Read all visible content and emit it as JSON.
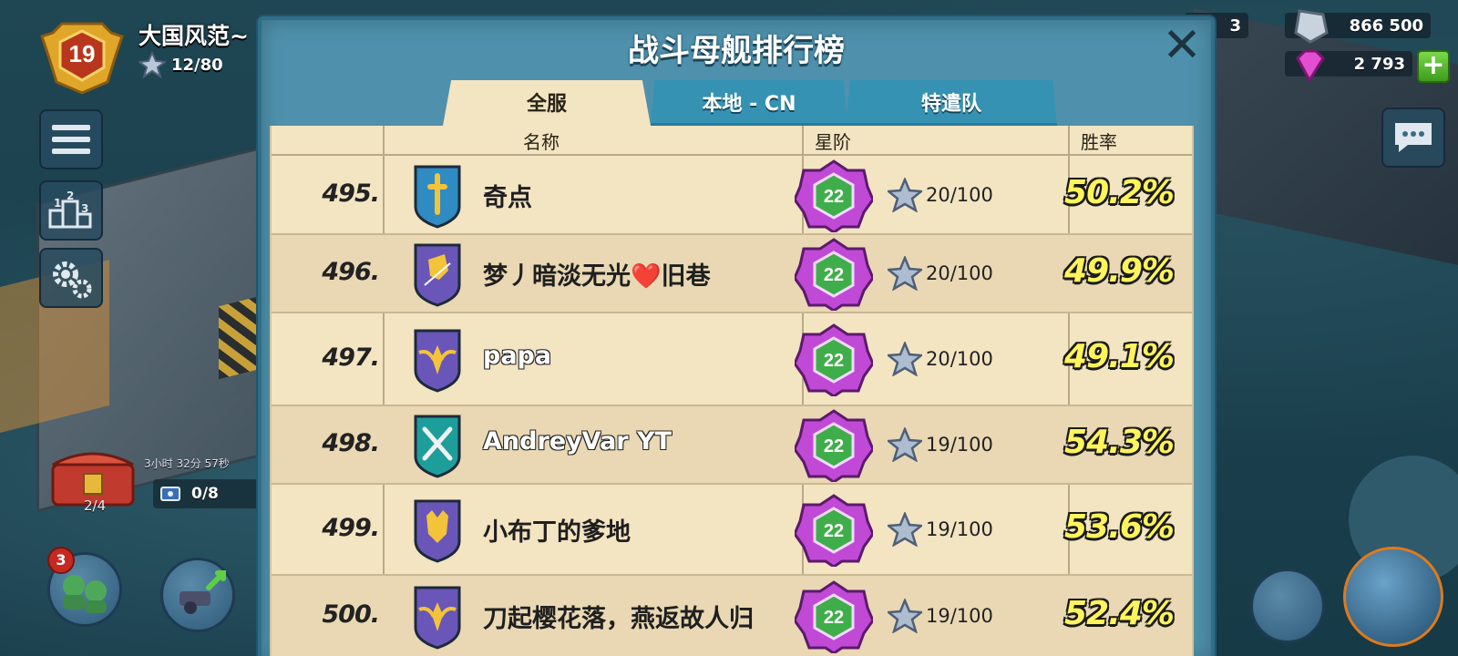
{
  "hud": {
    "level": "19",
    "player_name": "大国风范~",
    "stars": "12/80",
    "chest_timer": "3小时 32分 57秒",
    "chest_count": "2/4",
    "key_count": "0/8",
    "notification_count": "3",
    "partial_resource": "3",
    "iron_amount": "866 500",
    "gems_amount": "2 793",
    "icons": [
      "level-shield-icon",
      "silver-star-icon",
      "menu-icon",
      "leaderboard-icon",
      "settings-gear-icon",
      "chest-icon",
      "key-icon",
      "chat-icon",
      "iron-icon",
      "gem-icon",
      "plus-icon"
    ]
  },
  "panel": {
    "title": "战斗母舰排行榜",
    "close_symbol": "✕",
    "tabs": [
      {
        "label": "全服",
        "active": true
      },
      {
        "label": "本地 - CN",
        "active": false
      },
      {
        "label": "特遣队",
        "active": false
      }
    ],
    "columns": {
      "name": "名称",
      "tier": "星阶",
      "winrate": "胜率"
    },
    "rows": [
      {
        "rank": "495.",
        "name": "奇点",
        "emblem": "dagger-shield-icon",
        "emblem_color": "#2f8bc2",
        "tier": "22",
        "stars": "20/100",
        "winrate": "50.2%"
      },
      {
        "rank": "496.",
        "name": "梦丿暗淡无光❤️旧巷",
        "emblem": "fist-shield-icon",
        "emblem_color": "#6a56b8",
        "tier": "22",
        "stars": "20/100",
        "winrate": "49.9%"
      },
      {
        "rank": "497.",
        "name": "papa",
        "emblem": "winged-shield-icon",
        "emblem_color": "#6a56b8",
        "tier": "22",
        "stars": "20/100",
        "winrate": "49.1%"
      },
      {
        "rank": "498.",
        "name": "AndreyVar YT",
        "emblem": "crossed-rifles-shield-icon",
        "emblem_color": "#1e9e9a",
        "tier": "22",
        "stars": "19/100",
        "winrate": "54.3%"
      },
      {
        "rank": "499.",
        "name": "小布丁的爹地",
        "emblem": "wolf-shield-icon",
        "emblem_color": "#6a56b8",
        "tier": "22",
        "stars": "19/100",
        "winrate": "53.6%"
      },
      {
        "rank": "500.",
        "name": "刀起樱花落，燕返故人归",
        "emblem": "winged-shield-icon",
        "emblem_color": "#6a56b8",
        "tier": "22",
        "stars": "19/100",
        "winrate": "52.4%"
      }
    ]
  },
  "colors": {
    "panel_blue": "#4f91ac",
    "sheet_parchment": "#f3e4c2",
    "winrate_yellow": "#fff45c",
    "tier_purple": "#c04ad6",
    "tier_green": "#3fae4a"
  }
}
